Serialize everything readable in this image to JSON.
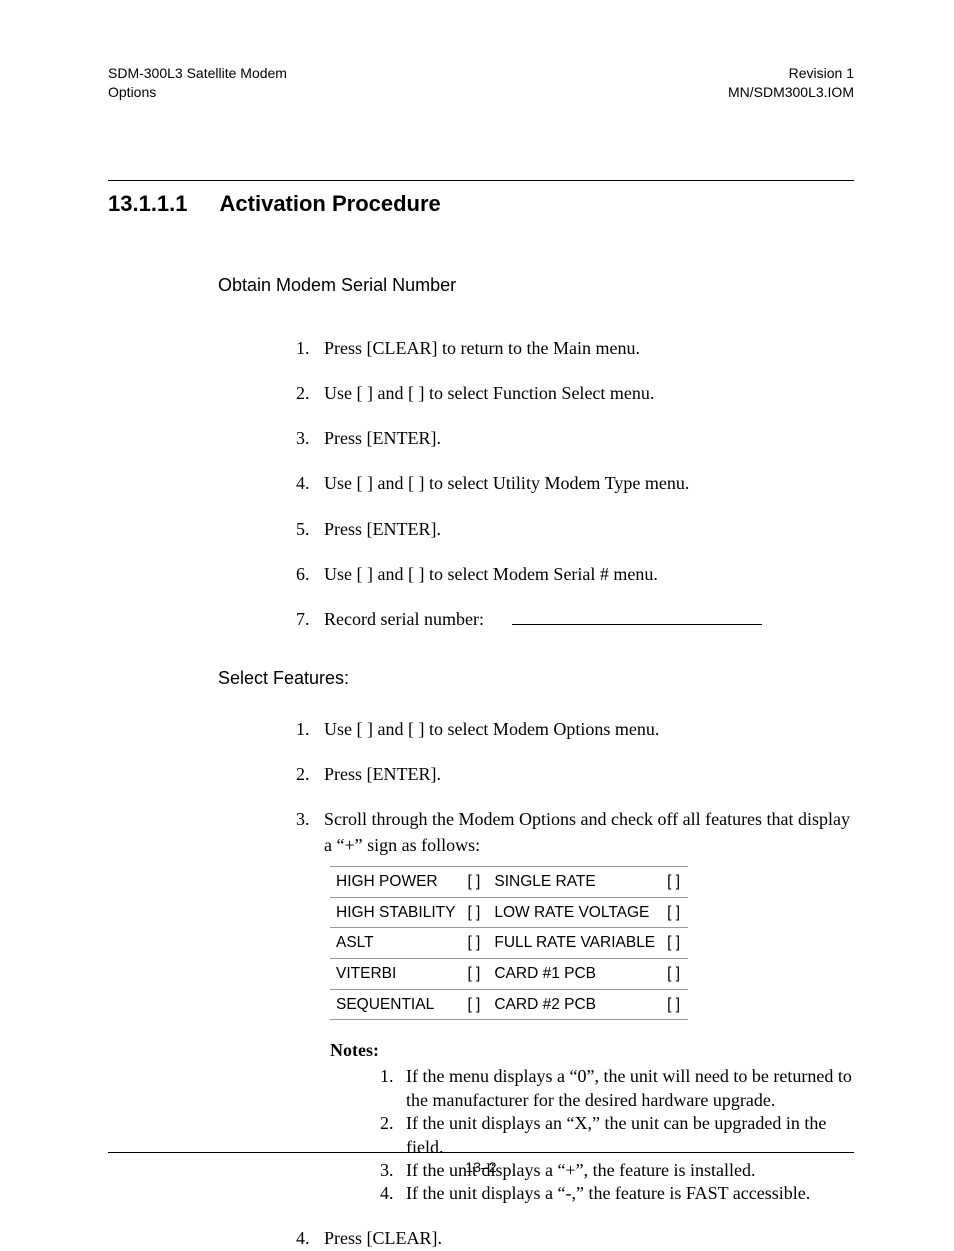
{
  "header": {
    "left_line1": "SDM-300L3 Satellite Modem",
    "left_line2": "Options",
    "right_line1": "Revision 1",
    "right_line2": "MN/SDM300L3.IOM"
  },
  "section": {
    "number": "13.1.1.1",
    "title": "Activation Procedure"
  },
  "sub1": {
    "heading": "Obtain Modem Serial Number",
    "steps": [
      "Press [CLEAR] to return to the Main menu.",
      "Use [   ] and [   ] to select Function Select menu.",
      "Press [ENTER].",
      "Use [   ] and [   ] to select Utility Modem Type menu.",
      "Press [ENTER].",
      "Use [   ] and [   ] to select Modem Serial # menu.",
      "Record serial number:"
    ]
  },
  "sub2": {
    "heading": "Select Features:",
    "steps": {
      "s1": "Use [   ] and [   ] to select Modem Options menu.",
      "s2": "Press [ENTER].",
      "s3": "Scroll through the Modem Options and check off all features that display a “+” sign as follows:",
      "s4": "Press [CLEAR]."
    }
  },
  "features": {
    "rows": [
      {
        "l": "HIGH POWER",
        "lc": "[  ]",
        "r": "SINGLE RATE",
        "rc": "[  ]"
      },
      {
        "l": "HIGH STABILITY",
        "lc": "[  ]",
        "r": "LOW RATE VOLTAGE",
        "rc": "[  ]"
      },
      {
        "l": "ASLT",
        "lc": "[  ]",
        "r": "FULL RATE VARIABLE",
        "rc": "[  ]"
      },
      {
        "l": "VITERBI",
        "lc": "[  ]",
        "r": "CARD #1 PCB",
        "rc": "[  ]"
      },
      {
        "l": "SEQUENTIAL",
        "lc": "[  ]",
        "r": "CARD #2 PCB",
        "rc": "[  ]"
      }
    ]
  },
  "notes": {
    "title": "Notes:",
    "items": [
      "If the menu displays a “0”, the unit will need to be returned to the manufacturer for the desired hardware upgrade.",
      "If the unit displays an “X,” the unit can be upgraded in the field.",
      "If the unit displays a “+”, the feature is installed.",
      "If the unit displays a “-,” the feature is FAST accessible."
    ]
  },
  "footer": {
    "page": "13–2"
  }
}
